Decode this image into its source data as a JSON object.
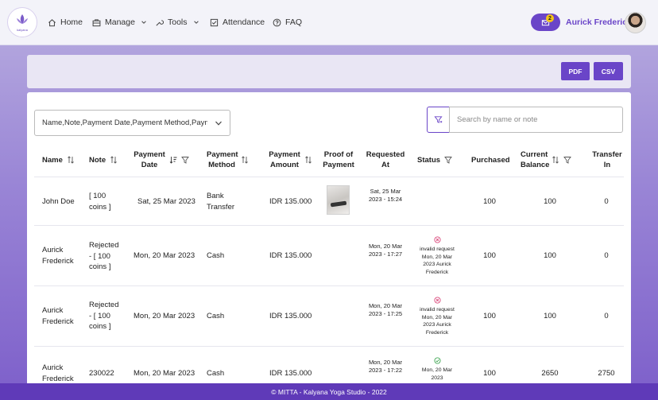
{
  "brand": {
    "logo_text": "kalyana"
  },
  "nav": {
    "home": "Home",
    "manage": "Manage",
    "tools": "Tools",
    "attendance": "Attendance",
    "faq": "FAQ"
  },
  "user": {
    "name": "Aurick Frederick",
    "notifications": "2"
  },
  "toolbar": {
    "pdf": "PDF",
    "csv": "CSV"
  },
  "filters": {
    "columns_selected": "Name,Note,Payment Date,Payment Method,Payment Amount,Proof of Payment",
    "search_placeholder": "Search by name or note"
  },
  "table": {
    "headers": {
      "name": "Name",
      "note": "Note",
      "payment_date": "Payment Date",
      "payment_method": "Payment Method",
      "payment_amount": "Payment Amount",
      "proof": "Proof of Payment",
      "requested_at": "Requested At",
      "status": "Status",
      "purchased": "Purchased",
      "current_balance": "Current Balance",
      "transfer_in": "Transfer In"
    },
    "rows": [
      {
        "name": "John Doe",
        "note": "[ 100 coins ]",
        "payment_date": "Sat, 25 Mar 2023",
        "payment_method": "Bank Transfer",
        "payment_amount": "IDR 135.000",
        "requested_at": "Sat, 25 Mar 2023 - 15:24",
        "status": "",
        "status_detail": "",
        "purchased": "100",
        "current_balance": "100",
        "transfer_in": "0"
      },
      {
        "name": "Aurick Frederick",
        "note": "Rejected - [ 100 coins ]",
        "payment_date": "Mon, 20 Mar 2023",
        "payment_method": "Cash",
        "payment_amount": "IDR 135.000",
        "requested_at": "Mon, 20 Mar 2023 - 17:27",
        "status": "invalid request",
        "status_detail": "Mon, 20 Mar 2023 Aurick Frederick",
        "purchased": "100",
        "current_balance": "100",
        "transfer_in": "0"
      },
      {
        "name": "Aurick Frederick",
        "note": "Rejected - [ 100 coins ]",
        "payment_date": "Mon, 20 Mar 2023",
        "payment_method": "Cash",
        "payment_amount": "IDR 135.000",
        "requested_at": "Mon, 20 Mar 2023 - 17:25",
        "status": "invalid request",
        "status_detail": "Mon, 20 Mar 2023 Aurick Frederick",
        "purchased": "100",
        "current_balance": "100",
        "transfer_in": "0"
      },
      {
        "name": "Aurick Frederick",
        "note": "230022",
        "payment_date": "Mon, 20 Mar 2023",
        "payment_method": "Cash",
        "payment_amount": "IDR 135.000",
        "requested_at": "Mon, 20 Mar 2023 - 17:22",
        "status": "",
        "status_detail": "Mon, 20 Mar 2023",
        "purchased": "100",
        "current_balance": "2650",
        "transfer_in": "2750"
      }
    ]
  },
  "colors": {
    "accent": "#6a45c8",
    "rejected": "#d6336c",
    "approved": "#2f9e44",
    "footer": "#5f3ab8"
  },
  "footer": {
    "text": "© MITTA - Kalyana Yoga Studio - 2022"
  }
}
